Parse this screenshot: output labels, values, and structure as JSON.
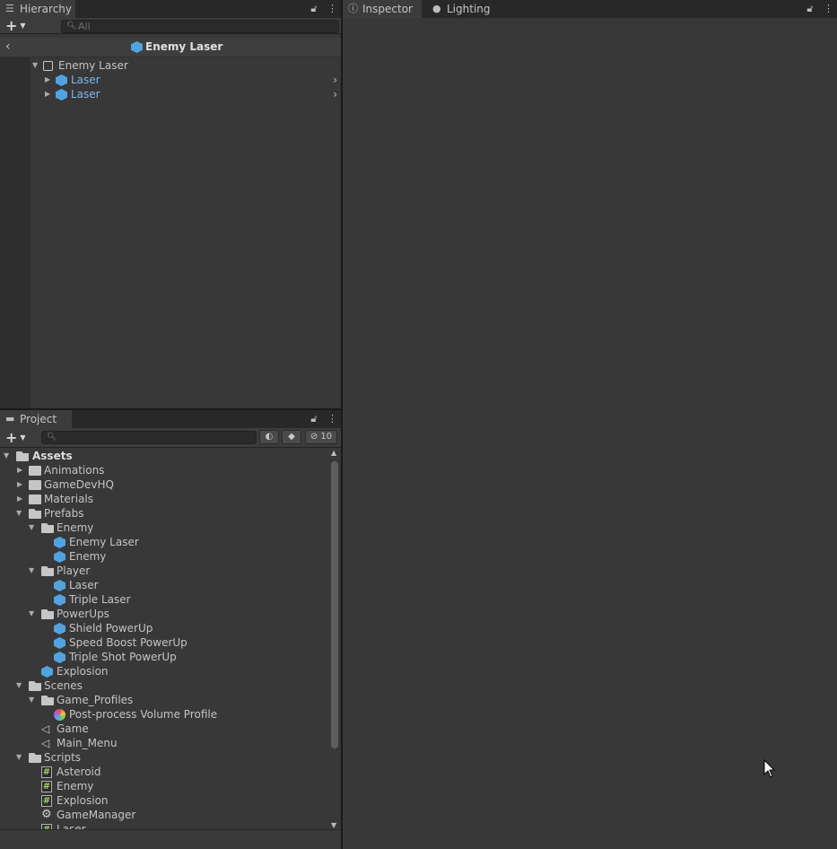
{
  "hierarchy": {
    "tab_label": "Hierarchy",
    "search_placeholder": "All",
    "prefab_title": "Enemy Laser",
    "tree": [
      {
        "label": "Enemy Laser",
        "kind": "root"
      },
      {
        "label": "Laser",
        "kind": "child"
      },
      {
        "label": "Laser",
        "kind": "child"
      }
    ]
  },
  "inspector": {
    "tabs": [
      {
        "label": "Inspector",
        "icon": "info-icon"
      },
      {
        "label": "Lighting",
        "icon": "lightbulb-icon"
      }
    ]
  },
  "project": {
    "tab_label": "Project",
    "hidden_count": "10",
    "tree": [
      {
        "label": "Assets",
        "icon": "folder-open",
        "expanded": true
      },
      {
        "label": "Animations",
        "icon": "folder"
      },
      {
        "label": "GameDevHQ",
        "icon": "folder"
      },
      {
        "label": "Materials",
        "icon": "folder"
      },
      {
        "label": "Prefabs",
        "icon": "folder-open",
        "expanded": true
      },
      {
        "label": "Enemy",
        "icon": "folder-open",
        "expanded": true
      },
      {
        "label": "Enemy Laser",
        "icon": "prefab"
      },
      {
        "label": "Enemy",
        "icon": "prefab"
      },
      {
        "label": "Player",
        "icon": "folder-open",
        "expanded": true
      },
      {
        "label": "Laser",
        "icon": "prefab"
      },
      {
        "label": "Triple Laser",
        "icon": "prefab"
      },
      {
        "label": "PowerUps",
        "icon": "folder-open",
        "expanded": true
      },
      {
        "label": "Shield PowerUp",
        "icon": "prefab"
      },
      {
        "label": "Speed Boost PowerUp",
        "icon": "prefab"
      },
      {
        "label": "Triple Shot PowerUp",
        "icon": "prefab"
      },
      {
        "label": "Explosion",
        "icon": "prefab"
      },
      {
        "label": "Scenes",
        "icon": "folder-open",
        "expanded": true
      },
      {
        "label": "Game_Profiles",
        "icon": "folder-open",
        "expanded": true
      },
      {
        "label": "Post-process Volume Profile",
        "icon": "profile"
      },
      {
        "label": "Game",
        "icon": "scene"
      },
      {
        "label": "Main_Menu",
        "icon": "scene"
      },
      {
        "label": "Scripts",
        "icon": "folder-open",
        "expanded": true
      },
      {
        "label": "Asteroid",
        "icon": "script"
      },
      {
        "label": "Enemy",
        "icon": "script"
      },
      {
        "label": "Explosion",
        "icon": "script"
      },
      {
        "label": "GameManager",
        "icon": "gear"
      },
      {
        "label": "Laser",
        "icon": "script"
      }
    ]
  },
  "colors": {
    "panel_bg": "#383838",
    "tab_bar": "#282828",
    "prefab_blue": "#4fa4e0",
    "child_text_blue": "#7ab6ef"
  }
}
